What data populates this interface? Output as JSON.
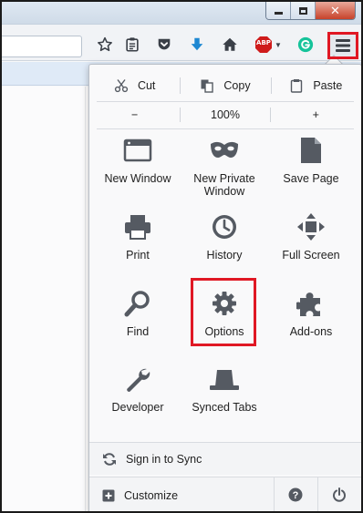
{
  "edit": {
    "cut_label": "Cut",
    "copy_label": "Copy",
    "paste_label": "Paste"
  },
  "zoom": {
    "out_label": "−",
    "level": "100%",
    "in_label": "+"
  },
  "grid": [
    {
      "label": "New Window",
      "icon": "new-window-icon"
    },
    {
      "label": "New Private Window",
      "icon": "mask-icon"
    },
    {
      "label": "Save Page",
      "icon": "document-icon"
    },
    {
      "label": "Print",
      "icon": "printer-icon"
    },
    {
      "label": "History",
      "icon": "clock-icon"
    },
    {
      "label": "Full Screen",
      "icon": "fullscreen-icon"
    },
    {
      "label": "Find",
      "icon": "magnifier-icon"
    },
    {
      "label": "Options",
      "icon": "gear-icon"
    },
    {
      "label": "Add-ons",
      "icon": "puzzle-icon"
    },
    {
      "label": "Developer",
      "icon": "wrench-icon"
    },
    {
      "label": "Synced Tabs",
      "icon": "synced-tabs-icon"
    }
  ],
  "footer": {
    "sync_label": "Sign in to Sync",
    "customize_label": "Customize"
  },
  "toolbar": {
    "abp_label": "ABP"
  },
  "colors": {
    "highlight": "#e01824",
    "icon": "#555a62",
    "download_arrow": "#1e88d2",
    "abp_red": "#cf1b1b",
    "grammarly_green": "#15c39a"
  }
}
